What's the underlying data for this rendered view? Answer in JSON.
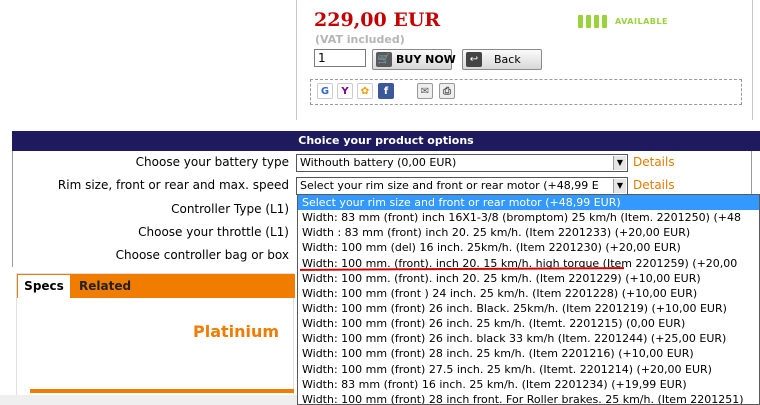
{
  "product": {
    "price": "229,00 EUR",
    "vat_note": "(VAT included)",
    "quantity": "1",
    "buy_label": "BUY NOW",
    "back_label": "Back",
    "availability": "AVAILABLE",
    "availability_color": "#9bd23a",
    "price_color": "#c40000"
  },
  "share_icons": [
    "google-icon",
    "yahoo-icon",
    "msn-icon",
    "facebook-icon",
    "email-icon",
    "print-icon"
  ],
  "options": {
    "header": "Choice your product options",
    "header_color": "#1f1a5e",
    "rows": [
      {
        "label": "Choose your battery type",
        "value": "Withouth battery (0,00 EUR)",
        "details": "Details"
      },
      {
        "label": "Rim size, front or rear and max. speed",
        "value": "Select your rim size and front or rear motor (+48,99 E",
        "details": "Details"
      },
      {
        "label": "Controller Type (L1)"
      },
      {
        "label": "Choose your throttle (L1)"
      },
      {
        "label": "Choose controller bag or box"
      }
    ]
  },
  "tabs": {
    "items": [
      "Specs",
      "Related"
    ],
    "accent_color": "#f07c00",
    "product_title": "Platinium"
  },
  "dropdown": {
    "items": [
      "Select your rim size and front or rear motor (+48,99 EUR)",
      "Width: 83 mm (front) inch 16X1-3/8 (bromptom) 25 km/h (Item. 2201250) (+48",
      "Width : 83 mm (front) inch 20. 25 km/h. (Item 2201233) (+20,00 EUR)",
      "Width: 100 mm (del) 16 inch. 25km/h. (Item 2201230) (+20,00 EUR)",
      "Width: 100 mm. (front). inch 20. 15 km/h. high torque (Item 2201259) (+20,00",
      "Width: 100 mm. (front). inch 20. 25 km/h. (Item 2201229) (+10,00 EUR)",
      "Width: 100 mm (front ) 24 inch. 25 km/h. (Item 2201228) (+10,00 EUR)",
      "Width: 100 mm (front) 26 inch. Black. 25km/h. (Item 2201219) (+10,00 EUR)",
      "Width: 100 mm (front) 26 inch. 25 km/h. (Itemt. 2201215) (0,00 EUR)",
      "Width: 100 mm (front) 26 inch. black 33 km/h (Item. 2201244) (+25,00 EUR)",
      "Width: 100 mm (front) 28 inch. 25 km/h. (Item 2201216) (+10,00 EUR)",
      "Width: 100 mm (front) 27.5 inch. 25 km/h. (Itemt. 2201214) (+20,00 EUR)",
      "Width: 83 mm (front) 16 inch. 25 km/h. (Item 2201234) (+19,99 EUR)",
      "Width: 100 mm (front) 28 inch front. For Roller brakes. 25 km/h. (Item 2201251)"
    ]
  }
}
